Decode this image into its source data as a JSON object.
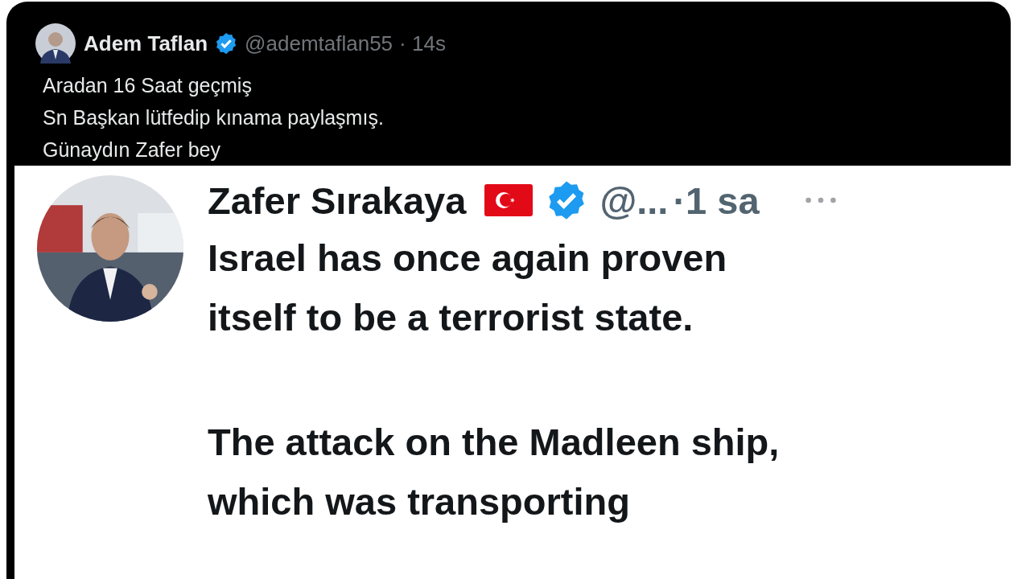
{
  "post": {
    "author": "Adem Taflan",
    "verified": true,
    "handle": "@ademtaflan55",
    "time": "· 14s",
    "lines": [
      "Aradan 16 Saat geçmiş",
      "Sn Başkan lütfedip kınama paylaşmış.",
      "Günaydın Zafer bey"
    ]
  },
  "quoted": {
    "author": "Zafer Sırakaya",
    "flag": true,
    "verified": true,
    "handle": "@...",
    "time": "·1 sa",
    "paragraphs": [
      [
        "Israel has once again proven",
        "itself to be a terrorist state."
      ],
      [
        "The attack on the Madleen ship,",
        "which was transporting"
      ]
    ]
  }
}
